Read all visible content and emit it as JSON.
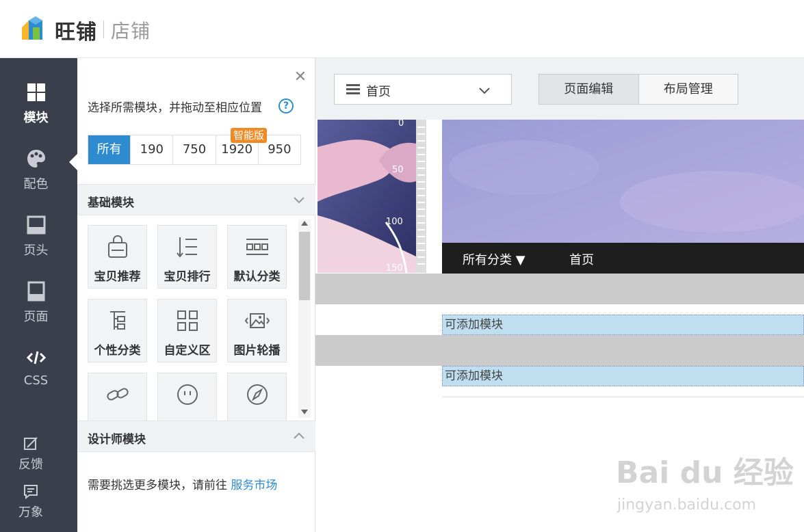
{
  "header": {
    "brand": "旺铺",
    "brand_sub": "店铺"
  },
  "sidebar": {
    "items": [
      {
        "label": "模块",
        "icon": "grid-icon",
        "active": true
      },
      {
        "label": "配色",
        "icon": "palette-icon"
      },
      {
        "label": "页头",
        "icon": "page-header-icon"
      },
      {
        "label": "页面",
        "icon": "page-icon"
      },
      {
        "label": "CSS",
        "icon": "code-icon"
      }
    ],
    "bottom": [
      {
        "label": "反馈",
        "icon": "feedback-icon"
      },
      {
        "label": "万象",
        "icon": "chat-icon"
      }
    ]
  },
  "panel": {
    "hint": "选择所需模块，并拖动至相应位置",
    "tabs": [
      "所有",
      "190",
      "750",
      "1920",
      "950"
    ],
    "smart_badge": "智能版",
    "basic_title": "基础模块",
    "modules": [
      {
        "label": "宝贝推荐",
        "icon": "bag-icon"
      },
      {
        "label": "宝贝排行",
        "icon": "rank-list-icon"
      },
      {
        "label": "默认分类",
        "icon": "category-icon"
      },
      {
        "label": "个性分类",
        "icon": "tree-icon"
      },
      {
        "label": "自定义区",
        "icon": "custom-grid-icon"
      },
      {
        "label": "图片轮播",
        "icon": "image-carousel-icon"
      },
      {
        "label": "",
        "icon": "link-icon"
      },
      {
        "label": "",
        "icon": "smile-icon"
      },
      {
        "label": "",
        "icon": "compass-icon"
      }
    ],
    "designer_title": "设计师模块",
    "more_text": "需要挑选更多模块，请前往 ",
    "more_link": "服务市场"
  },
  "main": {
    "page_select": "首页",
    "buttons": [
      "页面编辑",
      "布局管理"
    ],
    "ruler_labels": [
      "0",
      "50",
      "100",
      "150"
    ],
    "nav_all": "所有分类 ▼",
    "nav_home": "首页",
    "drop_zone_1": "可添加模块",
    "drop_zone_2": "可添加模块"
  },
  "watermark": {
    "text": "Bai du 经验",
    "sub": "jingyan.baidu.com"
  },
  "colors": {
    "accent": "#2f8bd0",
    "sidebar_bg": "#3a3f4b",
    "badge": "#f08a24",
    "drop_zone": "#bfdff0"
  }
}
